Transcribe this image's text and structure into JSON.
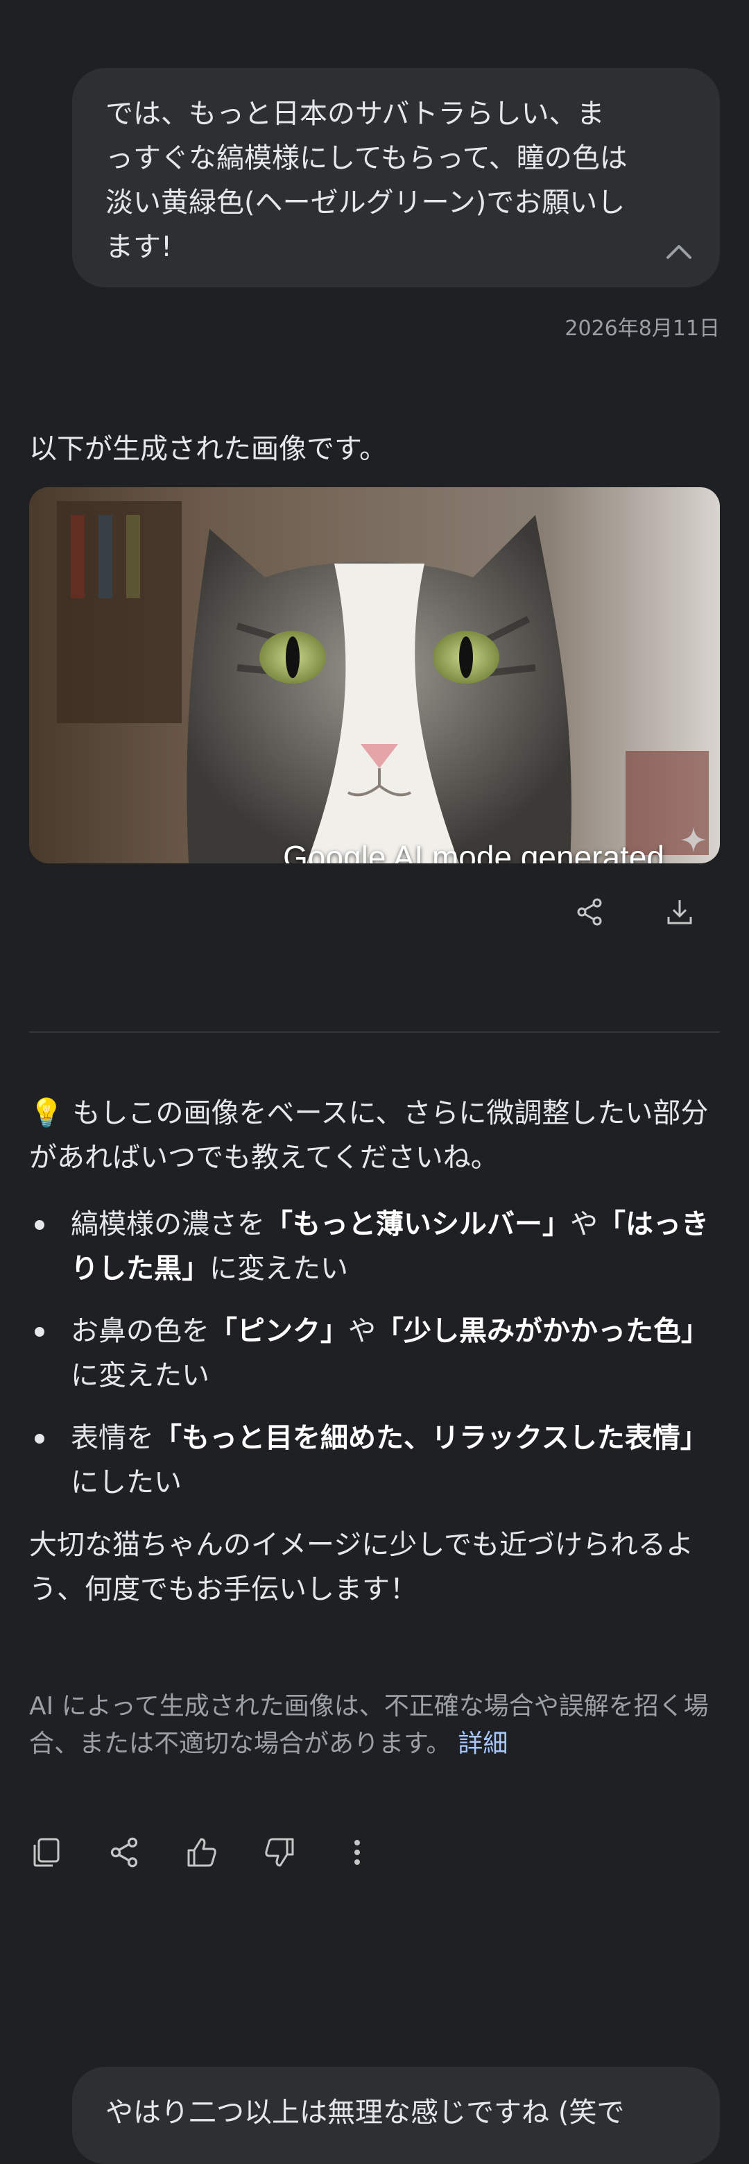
{
  "user_message_1": "では、もっと日本のサバトラらしい、ま\nっすぐな縞模様にしてもらって、瞳の色は\n淡い黄緑色(ヘーゼルグリーン)でお願いし\nます!",
  "timestamp": "2026年8月11日",
  "response": {
    "intro": "以下が生成された画像です。",
    "image": {
      "watermark": "Google AI mode generated",
      "subject": "cat-photo"
    },
    "tip_emoji": "💡",
    "tip_text": " もしこの画像をベースに、さらに微調整したい部分があればいつでも教えてくださいね。",
    "bullets": [
      {
        "pre": "縞模様の濃さを",
        "b1": "「もっと薄いシルバー」",
        "mid": "や",
        "b2": "「はっきりした黒」",
        "post": "に変えたい"
      },
      {
        "pre": "お鼻の色を",
        "b1": "「ピンク」",
        "mid": "や",
        "b2": "「少し黒みがかかった色」",
        "post": "に変えたい"
      },
      {
        "pre": "表情を",
        "b1": "「もっと目を細めた、リラックスした表情」",
        "mid": "",
        "b2": "",
        "post": "にしたい"
      }
    ],
    "closing": "大切な猫ちゃんのイメージに少しでも近づけられるよう、何度でもお手伝いします！",
    "disclaimer": "AI によって生成された画像は、不正確な場合や誤解を招く場合、または不適切な場合があります。",
    "disclaimer_link": "詳細"
  },
  "icons": {
    "collapse": "chevron-up-icon",
    "share": "share-icon",
    "download": "download-icon",
    "copy": "copy-icon",
    "thumbs_up": "thumbs-up-icon",
    "thumbs_down": "thumbs-down-icon",
    "more": "more-vert-icon",
    "sparkle": "sparkle-icon"
  },
  "user_message_2": "やはり二つ以上は無理な感じですね (笑で",
  "colors": {
    "background": "#1f2023",
    "bubble": "#2d2f33",
    "text": "#e6e7ea",
    "muted": "#9aa0a6"
  }
}
